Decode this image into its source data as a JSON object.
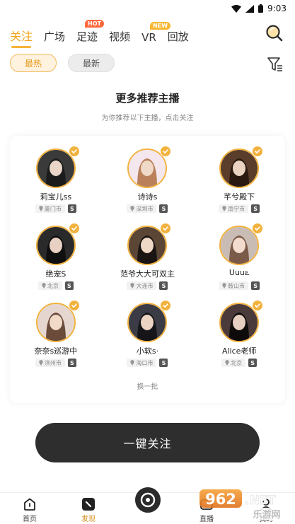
{
  "status_bar": {
    "time": "9:03"
  },
  "tabs": [
    {
      "label": "关注",
      "active": true
    },
    {
      "label": "广场"
    },
    {
      "label": "足迹",
      "badge": "HOT",
      "badge_type": "hot"
    },
    {
      "label": "视频"
    },
    {
      "label": "VR",
      "badge": "NEW",
      "badge_type": "new"
    },
    {
      "label": "回放"
    }
  ],
  "filters": [
    {
      "label": "最热",
      "active": true
    },
    {
      "label": "最新"
    }
  ],
  "section": {
    "title": "更多推荐主播",
    "subtitle": "为你推荐以下主播，点击关注"
  },
  "hosts": [
    {
      "name": "莉宝儿ss",
      "city": "厦门市",
      "level": "S"
    },
    {
      "name": "诗诗s",
      "city": "深圳市",
      "level": "S"
    },
    {
      "name": "芊兮殿下",
      "city": "南宁市",
      "level": "S"
    },
    {
      "name": "绝宠S",
      "city": "北京",
      "level": "S"
    },
    {
      "name": "范爷大大可双主",
      "city": "大连市",
      "level": "S"
    },
    {
      "name": "Uuuఽ",
      "city": "鞍山市",
      "level": "S"
    },
    {
      "name": "奈奈s巡游中",
      "city": "滨州市",
      "level": "S"
    },
    {
      "name": "小软s·",
      "city": "海口市",
      "level": "S"
    },
    {
      "name": "Alice老师",
      "city": "北京",
      "level": "S"
    }
  ],
  "refresh_label": "换一批",
  "follow_all_label": "一键关注",
  "bottom_nav": {
    "home": "首页",
    "discover": "发现",
    "live": "直播",
    "me": "我的"
  },
  "watermark": {
    "number": "962",
    "suffix": ".NET",
    "site": "乐游网"
  },
  "colors": {
    "accent": "#f2a41c",
    "dark_button": "#2e2e2e",
    "avatar_ring": "#f2b23e"
  }
}
